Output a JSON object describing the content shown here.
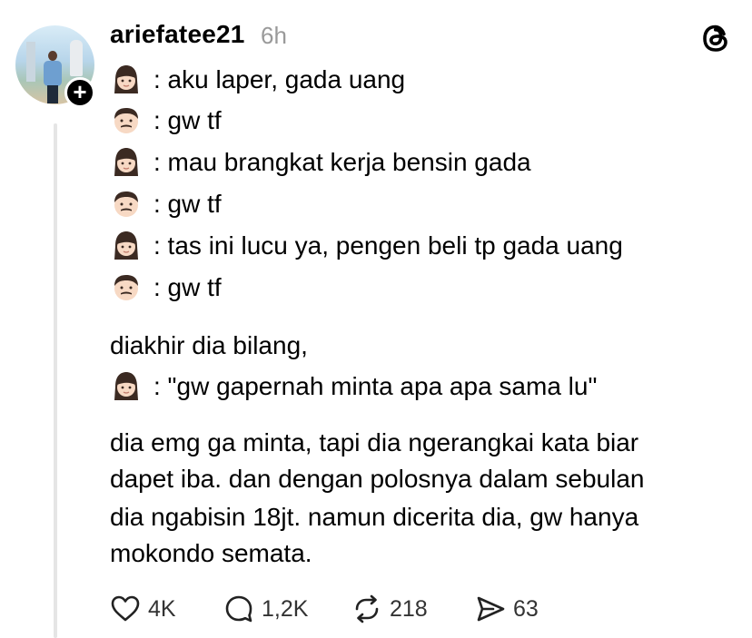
{
  "post": {
    "username": "ariefatee21",
    "time": "6h",
    "avatar_icon": "avatar-photo",
    "follow_icon": "plus-icon",
    "follow_symbol": "+",
    "brand_icon": "threads-logo-icon"
  },
  "dialogue": [
    {
      "speaker": "woman",
      "text": ": aku laper, gada uang"
    },
    {
      "speaker": "man",
      "text": ": gw tf"
    },
    {
      "speaker": "woman",
      "text": ": mau brangkat kerja bensin gada"
    },
    {
      "speaker": "man",
      "text": ": gw tf"
    },
    {
      "speaker": "woman",
      "text": ": tas ini lucu ya, pengen beli tp gada uang"
    },
    {
      "speaker": "man",
      "text": ": gw tf"
    }
  ],
  "ending": {
    "intro": "diakhir dia bilang,",
    "quote": ": \"gw gapernah minta apa apa sama lu\""
  },
  "closing_lines": [
    "dia emg ga minta, tapi dia ngerangkai kata biar",
    "dapet iba. dan dengan polosnya dalam sebulan",
    "dia ngabisin 18jt. namun dicerita dia, gw hanya",
    "mokondo semata."
  ],
  "actions": {
    "likes": "4K",
    "replies": "1,2K",
    "reposts": "218",
    "shares": "63"
  },
  "colors": {
    "text": "#000000",
    "muted": "#9a9a9a",
    "thread_line": "#e5e5e5"
  }
}
